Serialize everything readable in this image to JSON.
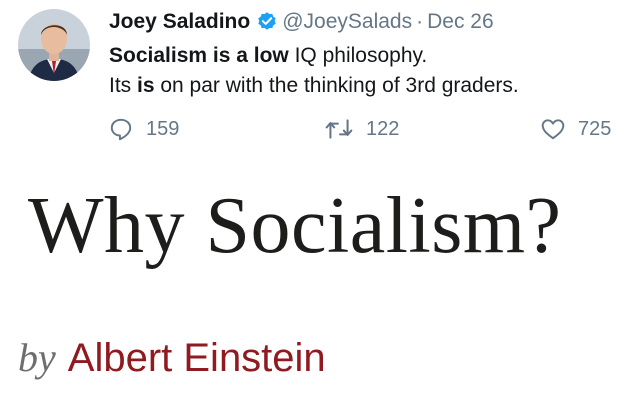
{
  "tweet": {
    "author_name": "Joey Saladino",
    "handle": "@JoeySalads",
    "separator": "·",
    "date": "Dec 26",
    "verified": true,
    "line1": {
      "bold": "Socialism is a low",
      "rest": " IQ philosophy."
    },
    "line2": {
      "before": "Its ",
      "bold": "is",
      "after": " on par with the thinking of 3rd graders."
    },
    "actions": {
      "replies": "159",
      "retweets": "122",
      "likes": "725"
    },
    "icons": {
      "verified": "verified-badge-icon",
      "reply": "reply-icon",
      "retweet": "retweet-icon",
      "like": "heart-icon"
    },
    "colors": {
      "verified": "#1da1f2",
      "secondary_text": "#657786"
    }
  },
  "image": {
    "title": "Why Socialism?",
    "by": "by",
    "author": "Albert Einstein",
    "colors": {
      "title": "#1d1d1b",
      "by": "#6e6e6e",
      "author": "#8f1a1f"
    }
  }
}
